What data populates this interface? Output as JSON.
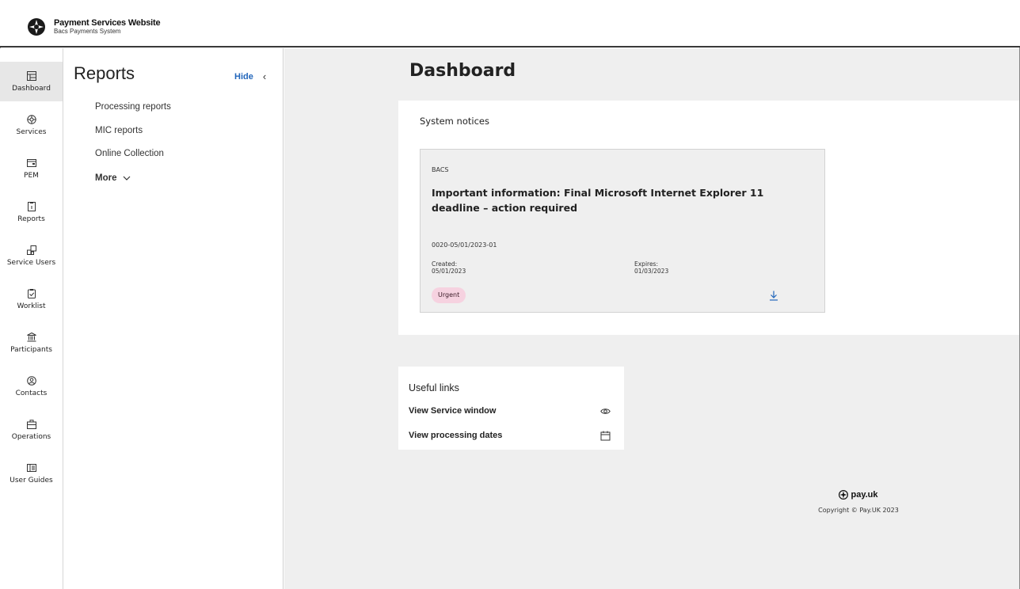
{
  "header": {
    "title": "Payment Services Website",
    "subtitle": "Bacs Payments System"
  },
  "rail": {
    "items": [
      {
        "label": "Dashboard",
        "icon": "dashboard-icon",
        "active": true
      },
      {
        "label": "Services",
        "icon": "services-icon"
      },
      {
        "label": "PEM",
        "icon": "pem-icon"
      },
      {
        "label": "Reports",
        "icon": "reports-icon"
      },
      {
        "label": "Service Users",
        "icon": "service-users-icon"
      },
      {
        "label": "Worklist",
        "icon": "worklist-icon"
      },
      {
        "label": "Participants",
        "icon": "participants-icon"
      },
      {
        "label": "Contacts",
        "icon": "contacts-icon"
      },
      {
        "label": "Operations",
        "icon": "operations-icon"
      },
      {
        "label": "User Guides",
        "icon": "user-guides-icon"
      }
    ]
  },
  "subnav": {
    "title": "Reports",
    "hide_label": "Hide",
    "links": [
      "Processing reports",
      "MIC reports",
      "Online Collection"
    ],
    "more_label": "More"
  },
  "main": {
    "title": "Dashboard",
    "notices": {
      "heading": "System notices",
      "card": {
        "tag": "BACS",
        "title": "Important information: Final Microsoft Internet Explorer 11 deadline – action required",
        "reference": "0020-05/01/2023-01",
        "created_label": "Created:",
        "created_value": "05/01/2023",
        "expires_label": "Expires:",
        "expires_value": "01/03/2023",
        "badge": "Urgent"
      }
    },
    "useful_links": {
      "heading": "Useful links",
      "items": [
        {
          "label": "View Service window",
          "icon": "eye-icon"
        },
        {
          "label": "View processing dates",
          "icon": "calendar-icon"
        }
      ]
    }
  },
  "footer": {
    "logo_text": "pay.uk",
    "copyright": "Copyright © Pay.UK 2023"
  },
  "colors": {
    "link_blue": "#2266bb",
    "urgent_bg": "#f6d2e0",
    "main_bg": "#efefef"
  }
}
